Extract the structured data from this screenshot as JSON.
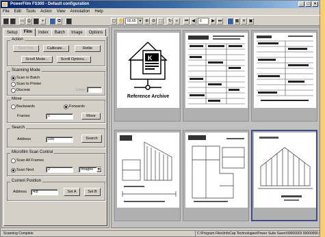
{
  "window": {
    "title": "PowerFilm FS300 - Default configuration"
  },
  "title_buttons": [
    "_",
    "□",
    "×"
  ],
  "menu": [
    "File",
    "Edit",
    "Tools",
    "Action",
    "View",
    "Annotation",
    "Help"
  ],
  "toolbar": {
    "zoom_value": "55.65",
    "page_value": "6",
    "page_total": "6"
  },
  "tabs": [
    "Setup",
    "Film",
    "Index",
    "Batch",
    "Image",
    "Options"
  ],
  "active_tab": "Film",
  "action": {
    "title": "Action",
    "find_film": "Find Film",
    "calibrate": "Calibrate...",
    "retile": "Retile",
    "scroll_mode": "Scroll Mode...",
    "scroll_options": "Scroll Options..."
  },
  "scanning_mode": {
    "title": "Scanning Mode",
    "options": [
      "Scan to Batch",
      "Scan to Printer",
      "Discrete"
    ],
    "selected": "Scan to Batch",
    "delay_label": "Delay"
  },
  "move": {
    "title": "Move",
    "backwards": "Backwards",
    "forwards": "Forwards",
    "selected": "Forwards",
    "frames_label": "Frames",
    "frames_value": "1",
    "move_button": "Move"
  },
  "search": {
    "title": "Search",
    "address_label": "Address",
    "address_value": "100",
    "search_button": "Search"
  },
  "scan_control": {
    "title": "Microfilm Scan Control",
    "scan_all": "Scan All Frames",
    "scan_next": "Scan Next",
    "selected": "Scan Next",
    "count_value": "2",
    "unit_value": "Images"
  },
  "current_position": {
    "title": "Current Position",
    "address_label": "Address",
    "address_value": "4/8",
    "set_a": "Set A",
    "set_b": "Set B"
  },
  "thumbnails": {
    "reference_caption": "Reference Archive",
    "logo_letter": "K",
    "selected_index": 5
  },
  "status": {
    "left": "Scanning Complete",
    "right": "C:\\Program Files\\InfoCap Technologies\\Power Suite Saver\\00000003 00000006.tif"
  }
}
